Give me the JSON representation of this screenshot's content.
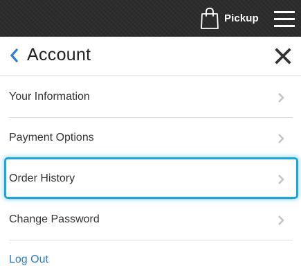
{
  "header": {
    "pickup_label": "Pickup",
    "icons": {
      "bag": "shopping-bag-icon",
      "menu": "hamburger-menu-icon"
    }
  },
  "account": {
    "title": "Account",
    "icons": {
      "back": "chevron-left-icon",
      "close": "close-icon",
      "row_chevron": "chevron-right-icon"
    },
    "items": [
      {
        "label": "Your Information"
      },
      {
        "label": "Payment Options"
      },
      {
        "label": "Order History",
        "highlighted": true
      },
      {
        "label": "Change Password"
      }
    ],
    "logout_label": "Log Out"
  },
  "colors": {
    "header_bg": "#2c2c2c",
    "accent_blue": "#2a7fd2",
    "highlight_border": "#19a8dc",
    "chevron_gray": "#c4c4c4"
  }
}
